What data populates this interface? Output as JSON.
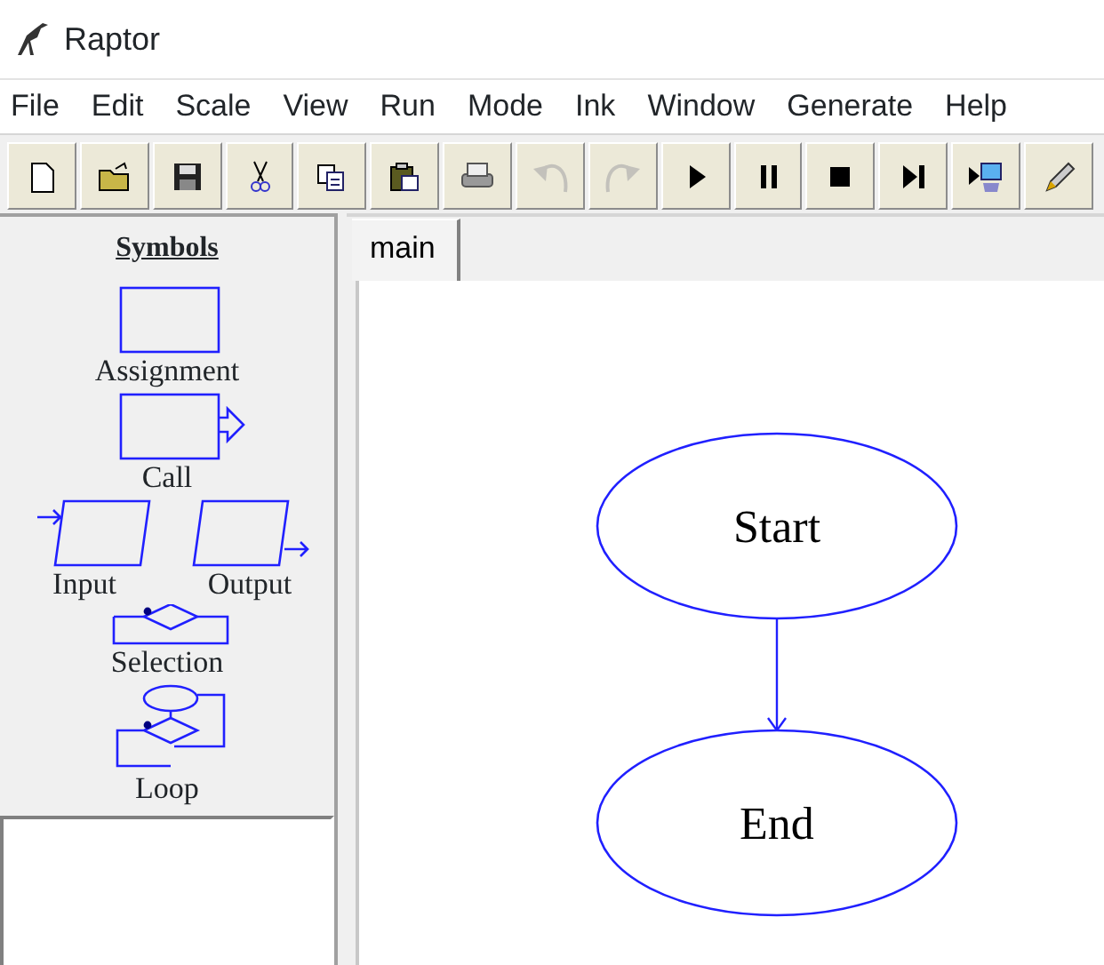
{
  "window": {
    "title": "Raptor"
  },
  "menu": [
    "File",
    "Edit",
    "Scale",
    "View",
    "Run",
    "Mode",
    "Ink",
    "Window",
    "Generate",
    "Help"
  ],
  "toolbar": [
    {
      "kind": "new",
      "disabled": false
    },
    {
      "kind": "open",
      "disabled": false
    },
    {
      "kind": "save",
      "disabled": false
    },
    {
      "kind": "cut",
      "disabled": false
    },
    {
      "kind": "copy",
      "disabled": false
    },
    {
      "kind": "paste",
      "disabled": false
    },
    {
      "kind": "print",
      "disabled": false
    },
    {
      "kind": "undo",
      "disabled": true
    },
    {
      "kind": "redo",
      "disabled": true
    },
    {
      "kind": "play",
      "disabled": false
    },
    {
      "kind": "pause",
      "disabled": false
    },
    {
      "kind": "stop",
      "disabled": false
    },
    {
      "kind": "step",
      "disabled": false
    },
    {
      "kind": "step-into",
      "disabled": false
    },
    {
      "kind": "pen",
      "disabled": false
    }
  ],
  "symbols_panel": {
    "title": "Symbols",
    "symbols": [
      {
        "kind": "assignment",
        "label": "Assignment"
      },
      {
        "kind": "call",
        "label": "Call"
      },
      {
        "kind": "input",
        "label": "Input"
      },
      {
        "kind": "output",
        "label": "Output"
      },
      {
        "kind": "selection",
        "label": "Selection"
      },
      {
        "kind": "loop",
        "label": "Loop"
      }
    ]
  },
  "tabs": [
    {
      "label": "main",
      "selected": true
    }
  ],
  "flowchart": {
    "nodes": [
      {
        "kind": "terminal",
        "label": "Start"
      },
      {
        "kind": "terminal",
        "label": "End"
      }
    ]
  }
}
